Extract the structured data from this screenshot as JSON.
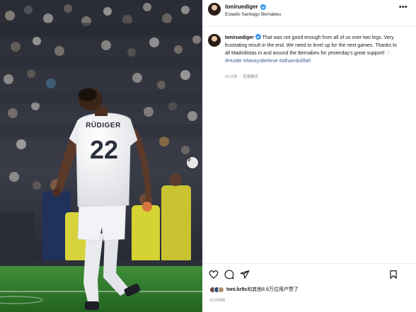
{
  "post": {
    "username": "toniruediger",
    "location": "Estadio Santiago Bernabeu",
    "caption_text": "That was not good enough from all of us over two legs. Very frustrating result in the end. We need to level up for the next games. Thanks to all Madridistas in and around the Bernabeu for yesterday's great support! ",
    "caption_heart": "♡",
    "hashtag_1": "#Hustle",
    "hashtag_2": "#AlwaysBelieve",
    "hashtag_3": "#alhamdulillah",
    "caption_time": "41分钟",
    "see_translation": "查看翻译",
    "likes_user": "toni.kr8s",
    "likes_rest": "和其他8.8万位用户赞了",
    "post_time": "41分钟前"
  },
  "photo": {
    "jersey_name": "RÜDIGER",
    "jersey_number": "22"
  },
  "colors": {
    "verified": "#3897f0",
    "hashtag": "#3d5f9a",
    "pitch": "#2e7a2c"
  },
  "icons": {
    "more": "more-options-icon",
    "like": "heart-icon",
    "comment": "comment-icon",
    "share": "paper-plane-icon",
    "save": "bookmark-icon",
    "next": "chevron-right-icon"
  }
}
